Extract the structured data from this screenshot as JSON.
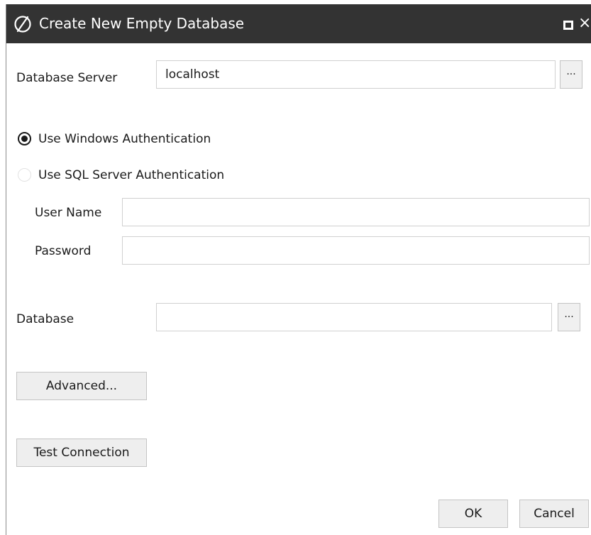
{
  "window": {
    "title": "Create New Empty Database",
    "icons": {
      "app": "database-app-icon",
      "maximize": "maximize-icon",
      "close": "close-icon"
    },
    "close_glyph": "×"
  },
  "server": {
    "label": "Database Server",
    "value": "localhost",
    "browse_label": "..."
  },
  "auth": {
    "windows_label": "Use Windows Authentication",
    "windows_selected": true,
    "sql_label": "Use SQL Server Authentication",
    "sql_selected": false,
    "username_label": "User Name",
    "username_value": "",
    "password_label": "Password",
    "password_value": ""
  },
  "database": {
    "label": "Database",
    "value": "",
    "browse_label": "..."
  },
  "buttons": {
    "advanced": "Advanced...",
    "test_connection": "Test Connection",
    "ok": "OK",
    "cancel": "Cancel"
  },
  "colors": {
    "titlebar": "#333333",
    "window_bg": "#ffffff",
    "button_bg": "#eeeeee",
    "border": "#c4c4c4"
  }
}
